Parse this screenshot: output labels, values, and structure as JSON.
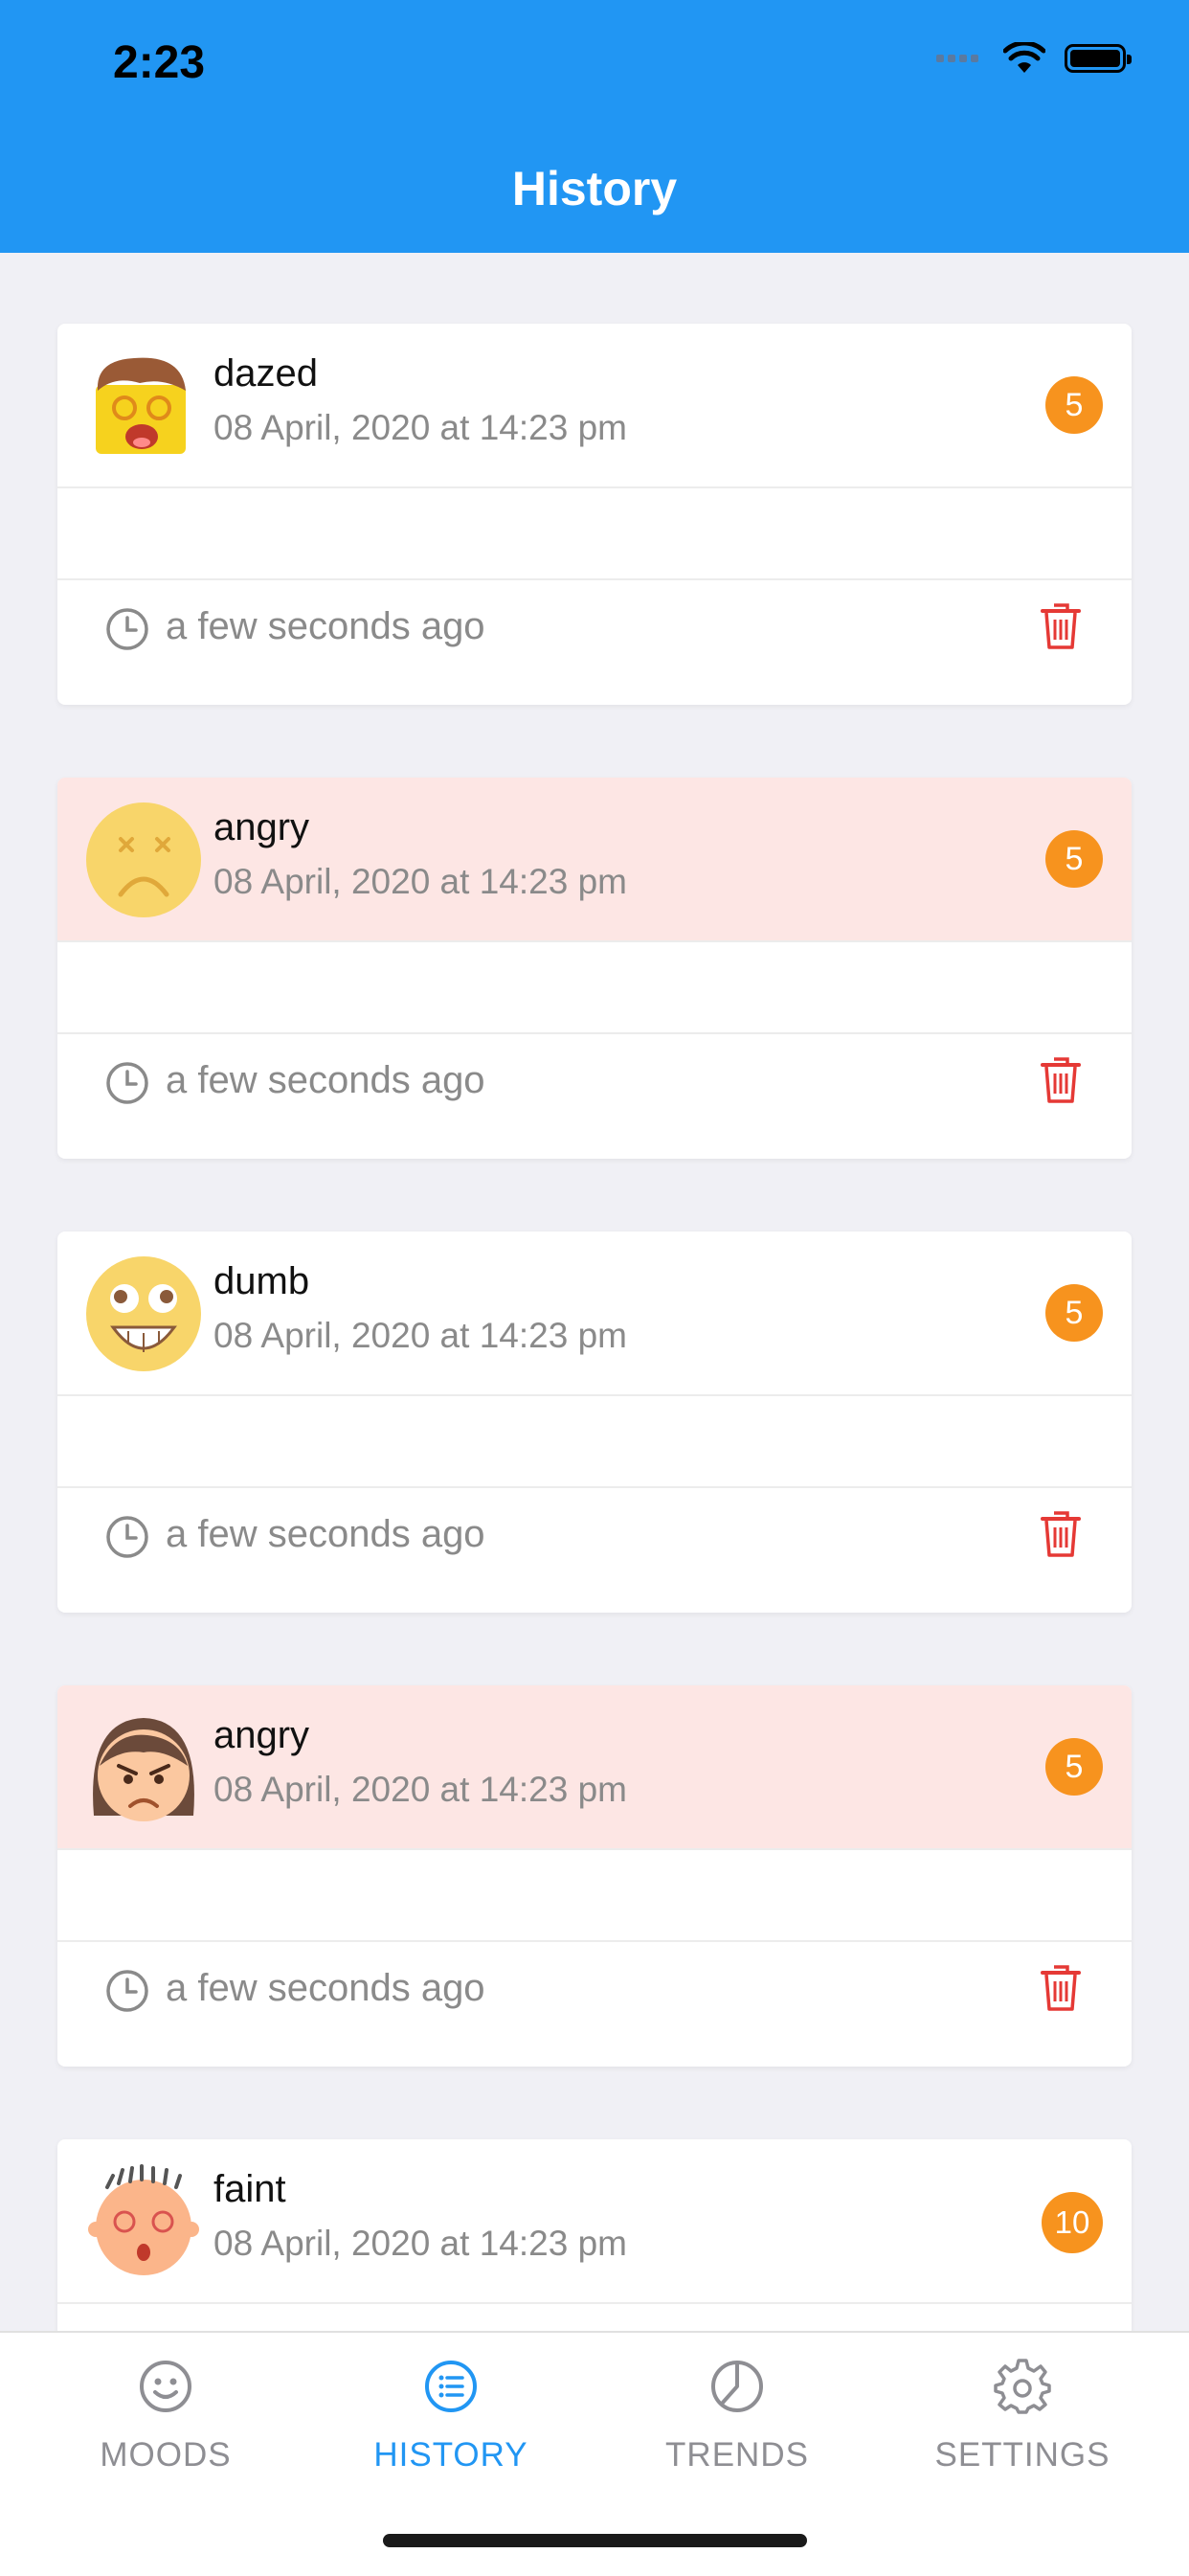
{
  "status_bar": {
    "time": "2:23"
  },
  "header": {
    "title": "History"
  },
  "entries": [
    {
      "mood": "dazed",
      "date": "08 April, 2020 at 14:23 pm",
      "score": "5",
      "ago": "a few seconds ago",
      "highlighted": false,
      "avatar": "dazed-face-icon"
    },
    {
      "mood": "angry",
      "date": "08 April, 2020 at 14:23 pm",
      "score": "5",
      "ago": "a few seconds ago",
      "highlighted": true,
      "avatar": "angry-face-icon"
    },
    {
      "mood": "dumb",
      "date": "08 April, 2020 at 14:23 pm",
      "score": "5",
      "ago": "a few seconds ago",
      "highlighted": false,
      "avatar": "dumb-face-icon"
    },
    {
      "mood": "angry",
      "date": "08 April, 2020 at 14:23 pm",
      "score": "5",
      "ago": "a few seconds ago",
      "highlighted": true,
      "avatar": "angry-girl-face-icon"
    },
    {
      "mood": "faint",
      "date": "08 April, 2020 at 14:23 pm",
      "score": "10",
      "ago": "",
      "highlighted": false,
      "avatar": "faint-face-icon"
    }
  ],
  "tabs": [
    {
      "label": "MOODS",
      "icon": "smiley-icon",
      "active": false
    },
    {
      "label": "HISTORY",
      "icon": "list-icon",
      "active": true
    },
    {
      "label": "TRENDS",
      "icon": "pie-chart-icon",
      "active": false
    },
    {
      "label": "SETTINGS",
      "icon": "gear-icon",
      "active": false
    }
  ],
  "colors": {
    "header": "#2196f3",
    "badge": "#f7931e",
    "highlight": "#fde6e4",
    "delete": "#e53935"
  }
}
